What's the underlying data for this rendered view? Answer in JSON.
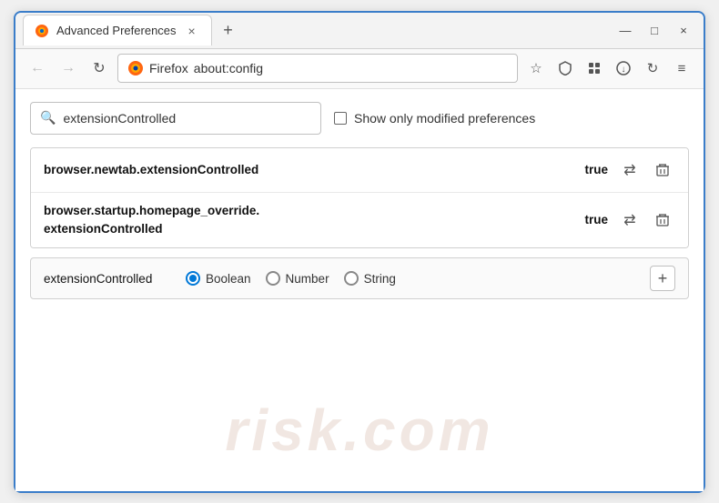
{
  "window": {
    "title": "Advanced Preferences",
    "tab_close": "×",
    "new_tab": "+",
    "win_minimize": "—",
    "win_maximize": "□",
    "win_close": "×"
  },
  "navbar": {
    "firefox_label": "Firefox",
    "address": "about:config"
  },
  "search": {
    "placeholder": "extensionControlled",
    "value": "extensionControlled",
    "checkbox_label": "Show only modified preferences"
  },
  "preferences": [
    {
      "name": "browser.newtab.extensionControlled",
      "value": "true"
    },
    {
      "name_line1": "browser.startup.homepage_override.",
      "name_line2": "extensionControlled",
      "value": "true"
    }
  ],
  "new_pref": {
    "name": "extensionControlled",
    "types": [
      "Boolean",
      "Number",
      "String"
    ],
    "selected_type": "Boolean",
    "add_btn_label": "+"
  },
  "watermark": {
    "text": "risk.com"
  },
  "icons": {
    "back": "←",
    "forward": "→",
    "reload": "↻",
    "star": "☆",
    "shield": "🛡",
    "extension": "🧩",
    "download": "📥",
    "sync": "↻",
    "menu": "≡",
    "search": "🔍",
    "swap": "⇄",
    "delete": "🗑"
  }
}
